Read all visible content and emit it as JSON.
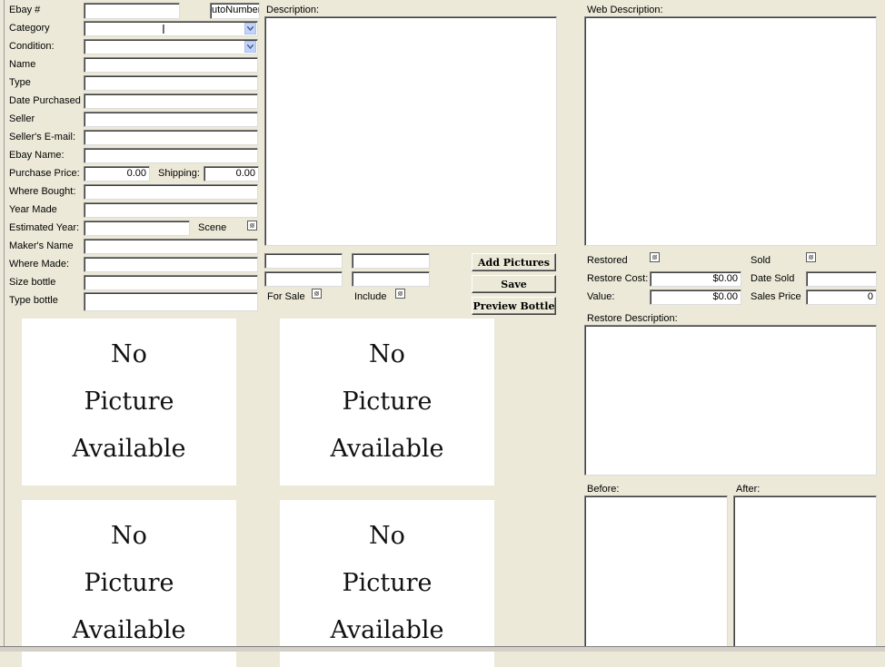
{
  "left_form": {
    "ebay_label": "Ebay #",
    "ebay_value": "",
    "autonumber": "utoNumber)",
    "category_label": "Category",
    "category_value": "",
    "condition_label": "Condition:",
    "condition_value": "",
    "name_label": "Name",
    "type_label": "Type",
    "date_purchased_label": "Date Purchased",
    "seller_label": "Seller",
    "seller_email_label": "Seller's E-mail:",
    "ebay_name_label": "Ebay Name:",
    "purchase_price_label": "Purchase Price:",
    "purchase_price_value": "0.00",
    "shipping_label": "Shipping:",
    "shipping_value": "0.00",
    "where_bought_label": "Where Bought:",
    "year_made_label": "Year Made",
    "estimated_year_label": "Estimated Year:",
    "scene_label": "Scene",
    "makers_name_label": "Maker's Name",
    "where_made_label": "Where Made:",
    "size_bottle_label": "Size bottle",
    "type_bottle_label": "Type bottle"
  },
  "middle": {
    "description_label": "Description:",
    "for_sale_label": "For Sale",
    "include_label": "Include",
    "add_pictures_button": "Add Pictures",
    "save_button": "Save",
    "preview_button": "Preview Bottle"
  },
  "pictures": [
    {
      "line1": "No",
      "line2": "Picture",
      "line3": "Available"
    },
    {
      "line1": "No",
      "line2": "Picture",
      "line3": "Available"
    },
    {
      "line1": "No",
      "line2": "Picture",
      "line3": "Available"
    },
    {
      "line1": "No",
      "line2": "Picture",
      "line3": "Available"
    }
  ],
  "right": {
    "web_description_label": "Web Description:",
    "restored_label": "Restored",
    "sold_label": "Sold",
    "restore_cost_label": "Restore Cost:",
    "restore_cost_value": "$0.00",
    "date_sold_label": "Date Sold",
    "value_label": "Value:",
    "value_value": "$0.00",
    "sales_price_label": "Sales Price",
    "sales_price_value": "0",
    "restore_description_label": "Restore Description:",
    "before_label": "Before:",
    "after_label": "After:"
  },
  "colors": {
    "background": "#ECE9D8",
    "combo_button": "#c1d3fb"
  }
}
